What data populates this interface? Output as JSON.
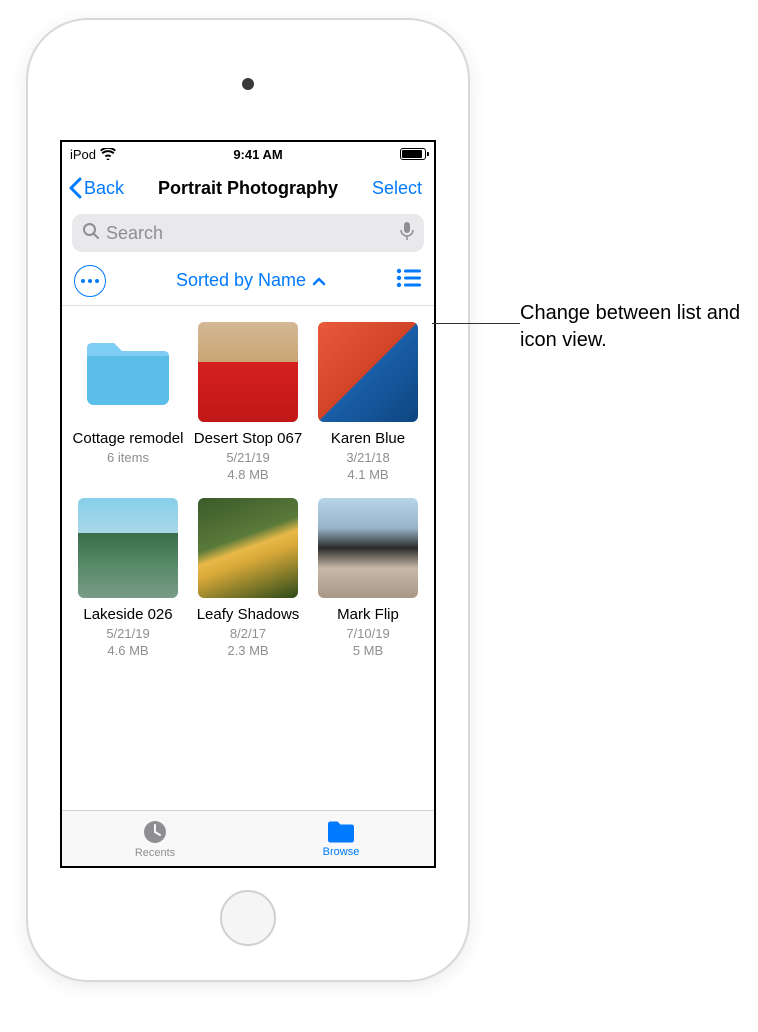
{
  "status": {
    "device": "iPod",
    "time": "9:41 AM"
  },
  "nav": {
    "back": "Back",
    "title": "Portrait Photography",
    "select": "Select"
  },
  "search": {
    "placeholder": "Search"
  },
  "toolbar": {
    "sort_label": "Sorted by Name"
  },
  "items": [
    {
      "name": "Cottage remodel",
      "meta1": "6 items",
      "meta2": "",
      "type": "folder"
    },
    {
      "name": "Desert Stop 067",
      "meta1": "5/21/19",
      "meta2": "4.8 MB",
      "type": "image"
    },
    {
      "name": "Karen Blue",
      "meta1": "3/21/18",
      "meta2": "4.1 MB",
      "type": "image"
    },
    {
      "name": "Lakeside 026",
      "meta1": "5/21/19",
      "meta2": "4.6 MB",
      "type": "image"
    },
    {
      "name": "Leafy Shadows",
      "meta1": "8/2/17",
      "meta2": "2.3 MB",
      "type": "image"
    },
    {
      "name": "Mark Flip",
      "meta1": "7/10/19",
      "meta2": "5 MB",
      "type": "image"
    }
  ],
  "tabs": {
    "recents": "Recents",
    "browse": "Browse"
  },
  "callout": {
    "text": "Change between list and icon view."
  }
}
